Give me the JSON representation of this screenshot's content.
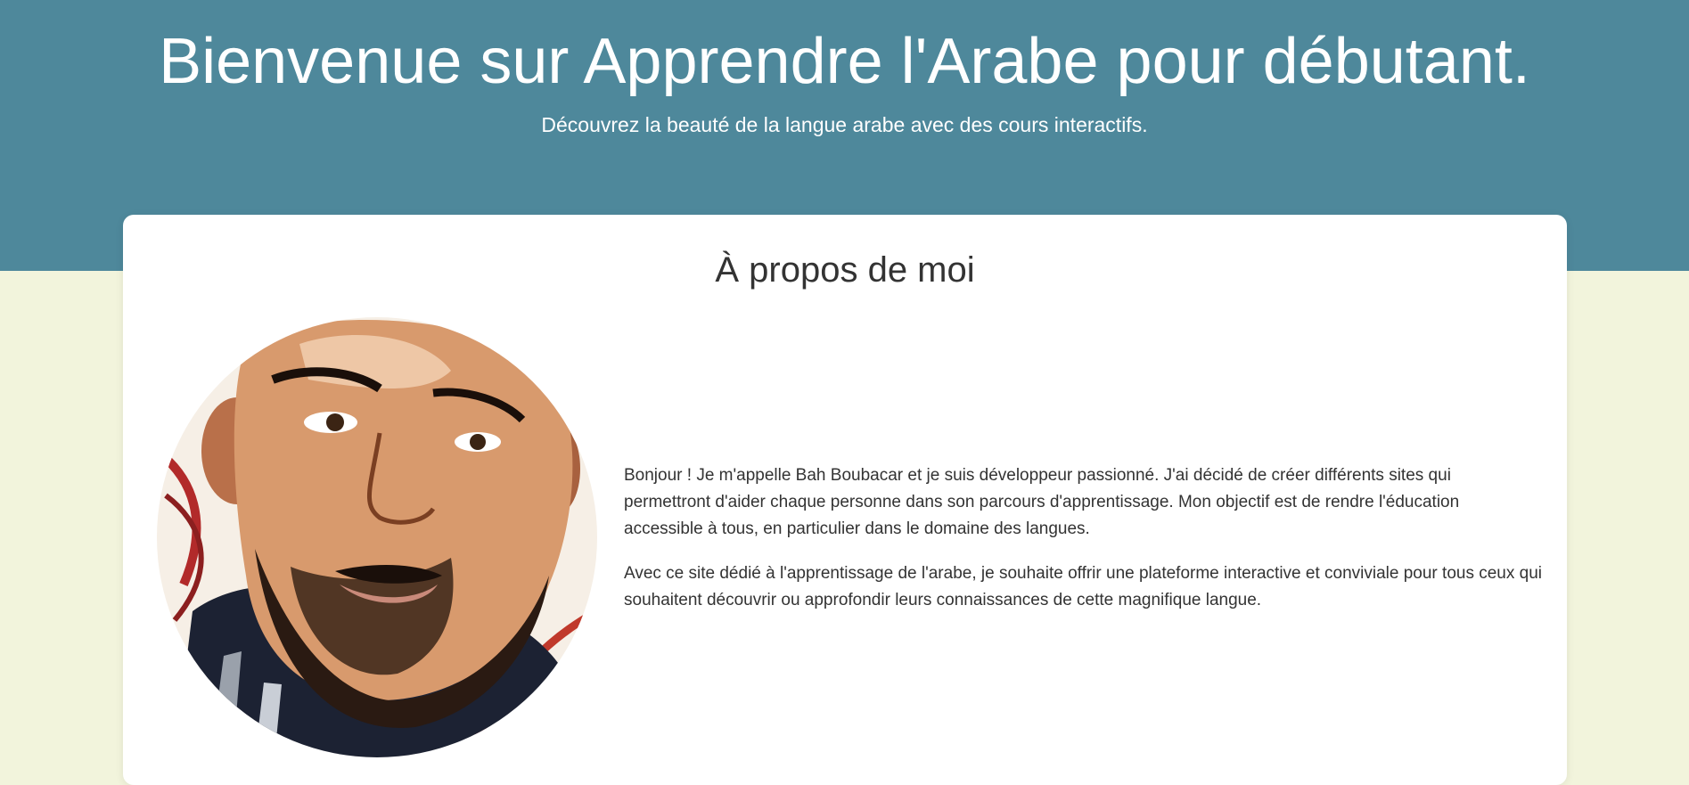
{
  "header": {
    "title": "Bienvenue sur Apprendre l'Arabe pour débutant.",
    "subtitle": "Découvrez la beauté de la langue arabe avec des cours interactifs."
  },
  "about": {
    "heading": "À propos de moi",
    "avatar_icon": "portrait-illustration",
    "paragraphs": [
      "Bonjour ! Je m'appelle Bah Boubacar et je suis développeur passionné. J'ai décidé de créer différents sites qui permettront d'aider chaque personne dans son parcours d'apprentissage. Mon objectif est de rendre l'éducation accessible à tous, en particulier dans le domaine des langues.",
      "Avec ce site dédié à l'apprentissage de l'arabe, je souhaite offrir une plateforme interactive et conviviale pour tous ceux qui souhaitent découvrir ou approfondir leurs connaissances de cette magnifique langue."
    ]
  },
  "colors": {
    "header_bg": "#4e889b",
    "page_bg": "#f2f4dc",
    "card_bg": "#ffffff",
    "text": "#333333"
  }
}
